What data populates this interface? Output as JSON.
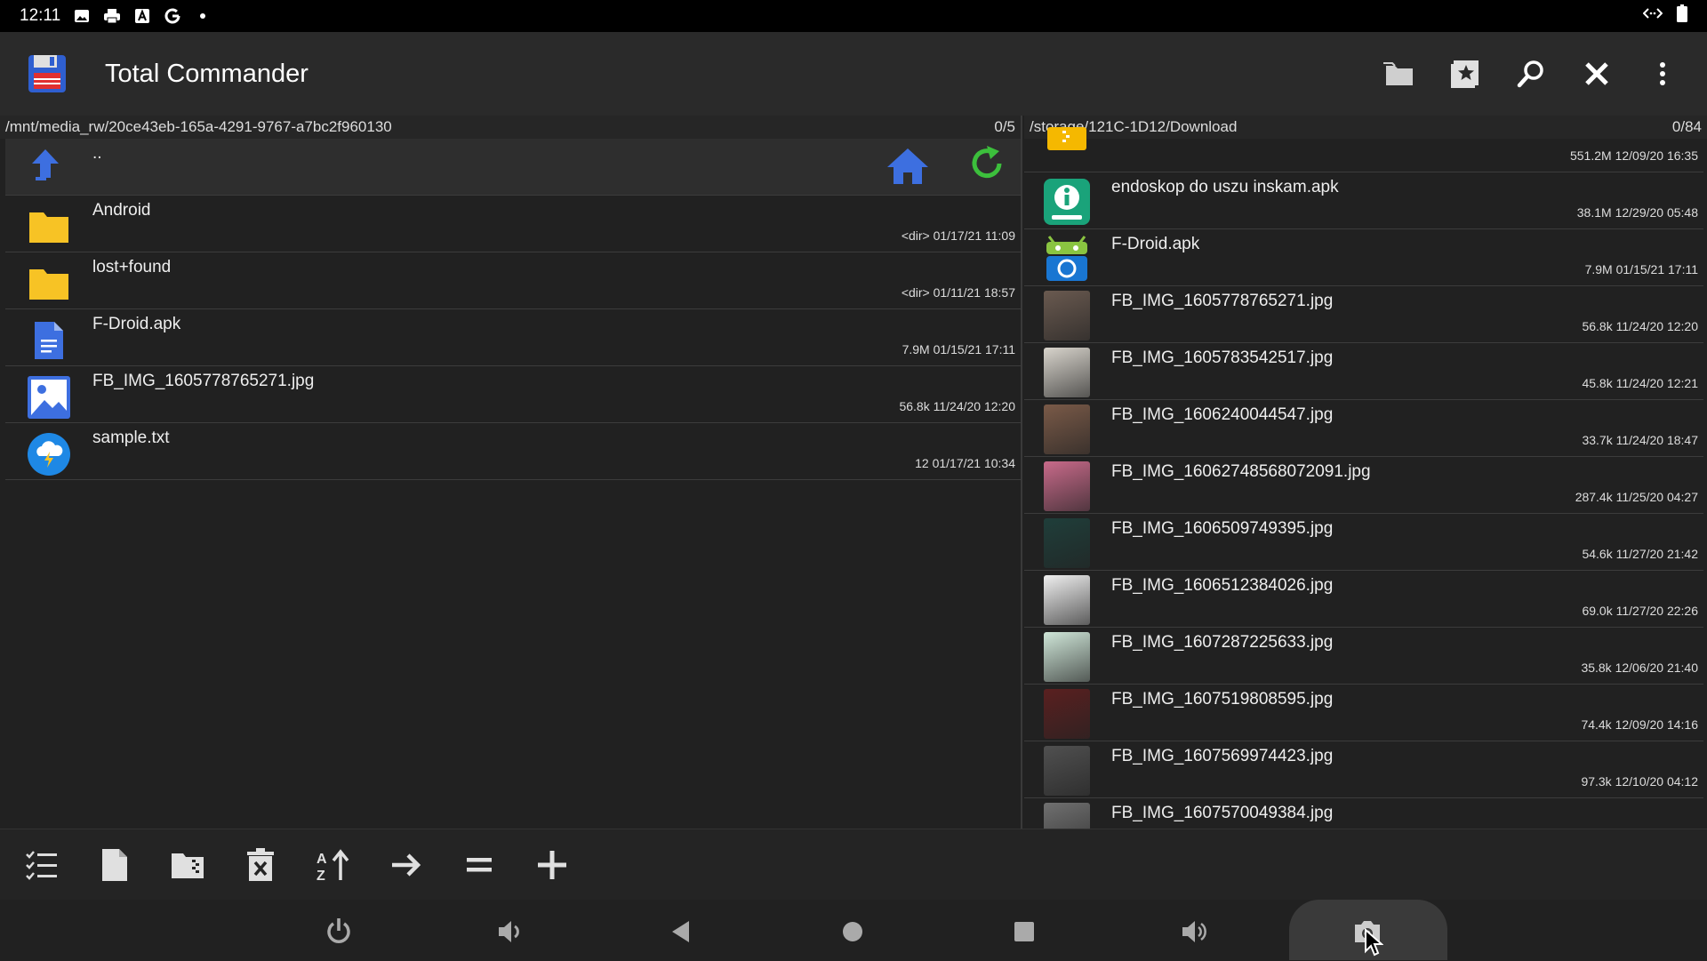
{
  "status": {
    "time": "12:11"
  },
  "app": {
    "title": "Total Commander"
  },
  "left_panel": {
    "path": "/mnt/media_rw/20ce43eb-165a-4291-9767-a7bc2f960130",
    "count": "0/5",
    "updir": "..",
    "rows": [
      {
        "name": "Android",
        "meta": "<dir>  01/17/21  11:09",
        "icon": "folder-icon"
      },
      {
        "name": "lost+found",
        "meta": "<dir>  01/11/21  18:57",
        "icon": "folder-icon"
      },
      {
        "name": "F-Droid.apk",
        "meta": "7.9M  01/15/21  17:11",
        "icon": "document-icon"
      },
      {
        "name": "FB_IMG_1605778765271.jpg",
        "meta": "56.8k  11/24/20  12:20",
        "icon": "image-icon"
      },
      {
        "name": "sample.txt",
        "meta": "12  01/17/21  10:34",
        "icon": "cloud-icon"
      }
    ]
  },
  "right_panel": {
    "path": "/storage/121C-1D12/Download",
    "count": "0/84",
    "rows": [
      {
        "name": "",
        "meta": "551.2M  12/09/20  16:35",
        "icon": "archive-icon",
        "color": "#f5b800"
      },
      {
        "name": "endoskop do uszu inskam.apk",
        "meta": "38.1M  12/29/20  05:48",
        "icon": "inskam-app-icon",
        "color": "#1aa37a"
      },
      {
        "name": "F-Droid.apk",
        "meta": "7.9M  01/15/21  17:11",
        "icon": "fdroid-icon",
        "color": "#8ac441"
      },
      {
        "name": "FB_IMG_1605778765271.jpg",
        "meta": "56.8k  11/24/20  12:20",
        "icon": "photo-thumbnail",
        "color": "#6a5a50"
      },
      {
        "name": "FB_IMG_1605783542517.jpg",
        "meta": "45.8k  11/24/20  12:21",
        "icon": "photo-thumbnail",
        "color": "#d8d4cc"
      },
      {
        "name": "FB_IMG_1606240044547.jpg",
        "meta": "33.7k  11/24/20  18:47",
        "icon": "photo-thumbnail",
        "color": "#7a5a48"
      },
      {
        "name": "FB_IMG_16062748568072091.jpg",
        "meta": "287.4k  11/25/20  04:27",
        "icon": "photo-thumbnail",
        "color": "#c86a8a"
      },
      {
        "name": "FB_IMG_1606509749395.jpg",
        "meta": "54.6k  11/27/20  21:42",
        "icon": "photo-thumbnail",
        "color": "#1f3e3a"
      },
      {
        "name": "FB_IMG_1606512384026.jpg",
        "meta": "69.0k  11/27/20  22:26",
        "icon": "photo-thumbnail",
        "color": "#efefef"
      },
      {
        "name": "FB_IMG_1607287225633.jpg",
        "meta": "35.8k  12/06/20  21:40",
        "icon": "photo-thumbnail",
        "color": "#cfe6d8"
      },
      {
        "name": "FB_IMG_1607519808595.jpg",
        "meta": "74.4k  12/09/20  14:16",
        "icon": "photo-thumbnail",
        "color": "#5a2020"
      },
      {
        "name": "FB_IMG_1607569974423.jpg",
        "meta": "97.3k  12/10/20  04:12",
        "icon": "photo-thumbnail",
        "color": "#505050"
      },
      {
        "name": "FB_IMG_1607570049384.jpg",
        "meta": "",
        "icon": "photo-thumbnail",
        "color": "#707070"
      }
    ]
  },
  "colors": {
    "accent_blue": "#3d6fe0",
    "folder_yellow": "#f7c325",
    "refresh_green": "#3cbf3c"
  }
}
